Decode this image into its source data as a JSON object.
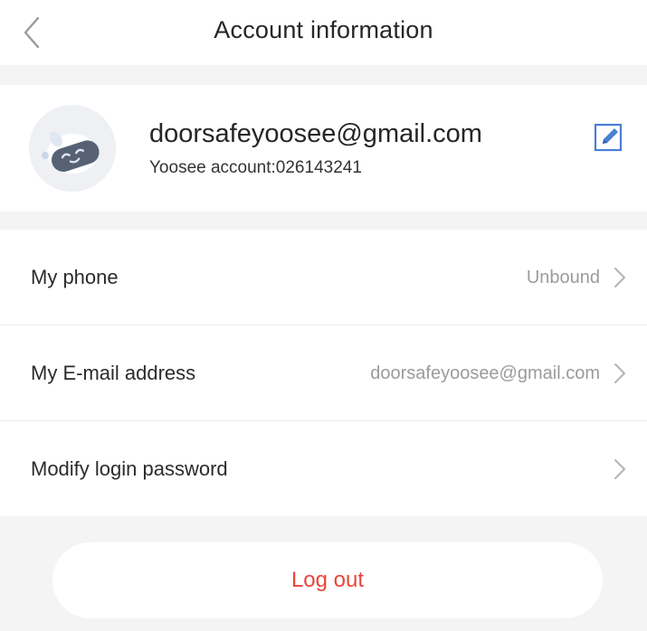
{
  "header": {
    "title": "Account information",
    "back_icon": "chevron-left-icon"
  },
  "profile": {
    "email": "doorsafeyoosee@gmail.com",
    "account_label": "Yoosee account:026143241",
    "avatar_icon": "robot-avatar-icon",
    "edit_icon": "edit-pencil-icon"
  },
  "settings": {
    "items": [
      {
        "label": "My phone",
        "value": "Unbound"
      },
      {
        "label": "My E-mail address",
        "value": "doorsafeyoosee@gmail.com"
      },
      {
        "label": "Modify login password",
        "value": ""
      }
    ]
  },
  "logout": {
    "label": "Log out"
  },
  "colors": {
    "accent": "#4a7fd4",
    "danger": "#e8463a",
    "background": "#f4f4f4",
    "secondary_text": "#9b9b9b"
  }
}
